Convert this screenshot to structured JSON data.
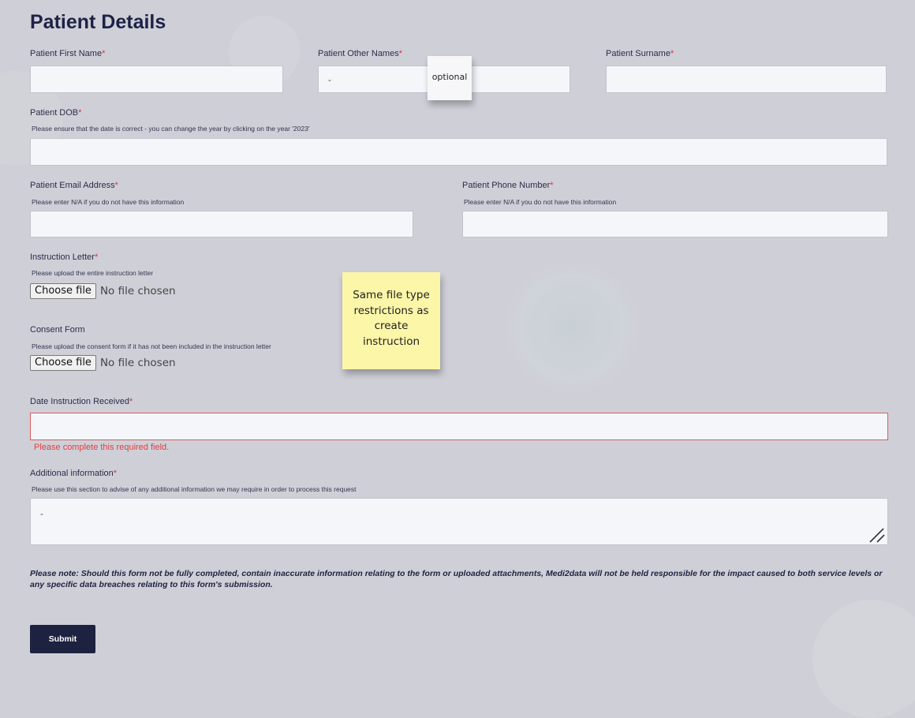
{
  "form": {
    "title": "Patient Details",
    "required_mark": "*",
    "first_name": {
      "label": "Patient First Name",
      "value": ""
    },
    "other_names": {
      "label": "Patient Other Names",
      "value": "-"
    },
    "surname": {
      "label": "Patient Surname",
      "value": ""
    },
    "dob": {
      "label": "Patient DOB",
      "hint": "Please ensure that the date is correct - you can change the year by clicking on the year '2023'",
      "value": ""
    },
    "email": {
      "label": "Patient Email Address",
      "hint": "Please enter N/A if you do not have this information",
      "value": ""
    },
    "phone": {
      "label": "Patient Phone Number",
      "hint": "Please enter N/A if you do not have this information",
      "value": ""
    },
    "instruction_letter": {
      "label": "Instruction Letter",
      "hint": "Please upload the entire instruction letter",
      "button": "Choose file",
      "status": "No file chosen"
    },
    "consent_form": {
      "label": "Consent Form",
      "hint": "Please upload the consent form if it has not been included in the instruction letter",
      "button": "Choose file",
      "status": "No file chosen"
    },
    "date_received": {
      "label": "Date Instruction Received",
      "value": "",
      "error": "Please complete this required field."
    },
    "additional_info": {
      "label": "Additional information",
      "hint": "Please use this section to advise of any additional information we may require in order to process this request",
      "value": "-"
    },
    "note": "Please note: Should this form not be fully completed, contain inaccurate information relating to the form or uploaded attachments, Medi2data will not be held responsible for the impact caused to both service levels or any specific data breaches relating to this form's submission.",
    "submit_label": "Submit"
  },
  "annotations": {
    "other_names_note": "optional",
    "file_type_note": "Same file type restrictions as create instruction"
  },
  "colors": {
    "background": "#cfcfd8",
    "primary": "#1d2240",
    "required": "#e0303a",
    "error": "#e05a5a",
    "sticky_note": "#fcf6a8"
  }
}
